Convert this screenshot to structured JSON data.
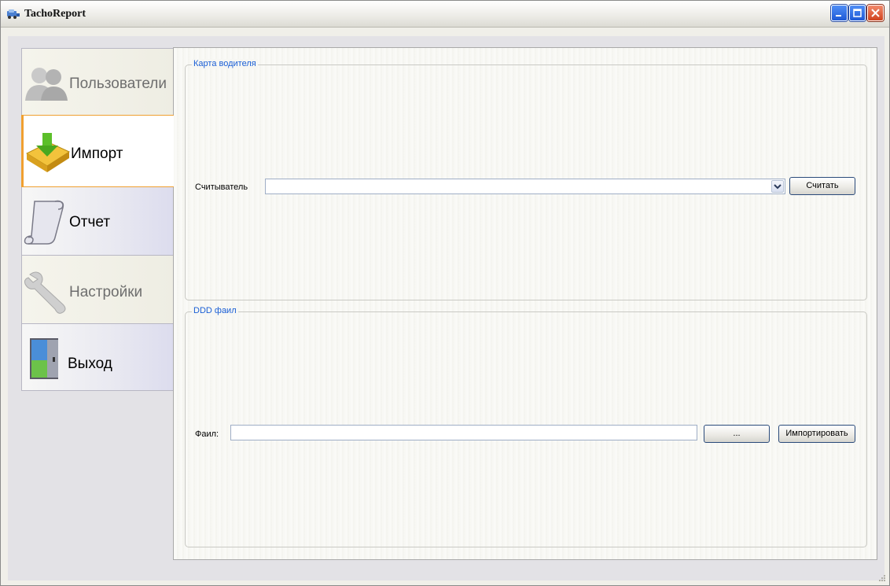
{
  "window": {
    "title": "TachoReport"
  },
  "icons": {
    "app": "app-icon",
    "minimize": "minimize-icon",
    "maximize": "maximize-icon",
    "close": "close-icon"
  },
  "nav": {
    "items": [
      {
        "label": "Пользователи",
        "state": "disabled",
        "icon": "users-icon"
      },
      {
        "label": "Импорт",
        "state": "active",
        "icon": "import-tray-icon"
      },
      {
        "label": "Отчет",
        "state": "enabled",
        "icon": "report-scroll-icon"
      },
      {
        "label": "Настройки",
        "state": "disabled",
        "icon": "wrench-icon"
      },
      {
        "label": "Выход",
        "state": "enabled",
        "icon": "exit-door-icon"
      }
    ]
  },
  "driver_card": {
    "title": "Карта водителя",
    "reader_label": "Считыватель",
    "reader_value": "",
    "read_button": "Считать"
  },
  "ddd_file": {
    "title": "DDD фаил",
    "file_label": "Фаил:",
    "file_value": "",
    "browse_button": "...",
    "import_button": "Импортировать"
  },
  "colors": {
    "group_title": "#1a5fd6",
    "active_tab_accent": "#f0a030",
    "close_button": "#d0421d",
    "titlebar_button": "#1f5ad6"
  }
}
